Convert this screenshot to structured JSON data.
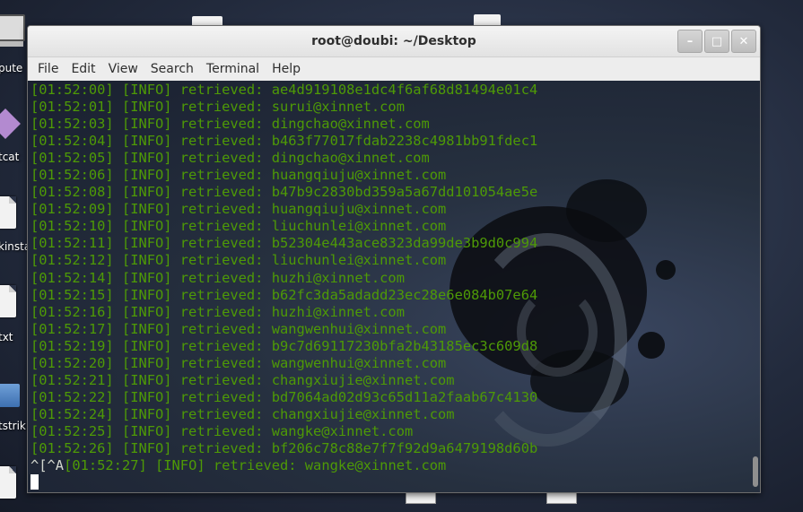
{
  "desktop": {
    "icons": [
      {
        "label": "pute"
      },
      {
        "label": "tcat"
      },
      {
        "label": "kinsta"
      },
      {
        "label": "txt"
      },
      {
        "label": "tstrik"
      }
    ]
  },
  "window": {
    "title": "root@doubi: ~/Desktop",
    "buttons": [
      "–",
      "□",
      "✕"
    ]
  },
  "menu": [
    "File",
    "Edit",
    "View",
    "Search",
    "Terminal",
    "Help"
  ],
  "terminal": {
    "lines": [
      "[01:52:00] [INFO] retrieved: ae4d919108e1dc4f6af68d81494e01c4",
      "[01:52:01] [INFO] retrieved: surui@xinnet.com",
      "[01:52:03] [INFO] retrieved: dingchao@xinnet.com",
      "[01:52:04] [INFO] retrieved: b463f77017fdab2238c4981bb91fdec1",
      "[01:52:05] [INFO] retrieved: dingchao@xinnet.com",
      "[01:52:06] [INFO] retrieved: huangqiuju@xinnet.com",
      "[01:52:08] [INFO] retrieved: b47b9c2830bd359a5a67dd101054ae5e",
      "[01:52:09] [INFO] retrieved: huangqiuju@xinnet.com",
      "[01:52:10] [INFO] retrieved: liuchunlei@xinnet.com",
      "[01:52:11] [INFO] retrieved: b52304e443ace8323da99de3b9d0c994",
      "[01:52:12] [INFO] retrieved: liuchunlei@xinnet.com",
      "[01:52:14] [INFO] retrieved: huzhi@xinnet.com",
      "[01:52:15] [INFO] retrieved: b62fc3da5adadd23ec28e6e084b07e64",
      "[01:52:16] [INFO] retrieved: huzhi@xinnet.com",
      "[01:52:17] [INFO] retrieved: wangwenhui@xinnet.com",
      "[01:52:19] [INFO] retrieved: b9c7d69117230bfa2b43185ec3c609d8",
      "[01:52:20] [INFO] retrieved: wangwenhui@xinnet.com",
      "[01:52:21] [INFO] retrieved: changxiujie@xinnet.com",
      "[01:52:22] [INFO] retrieved: bd7064ad02d93c65d11a2faab67c4130",
      "[01:52:24] [INFO] retrieved: changxiujie@xinnet.com",
      "[01:52:25] [INFO] retrieved: wangke@xinnet.com",
      "[01:52:26] [INFO] retrieved: bf206c78c88e7f7f92d9a6479198d60b"
    ],
    "last_prefix": "^[^A",
    "last_line": "[01:52:27] [INFO] retrieved: wangke@xinnet.com",
    "text_color": "#4e9a06"
  }
}
